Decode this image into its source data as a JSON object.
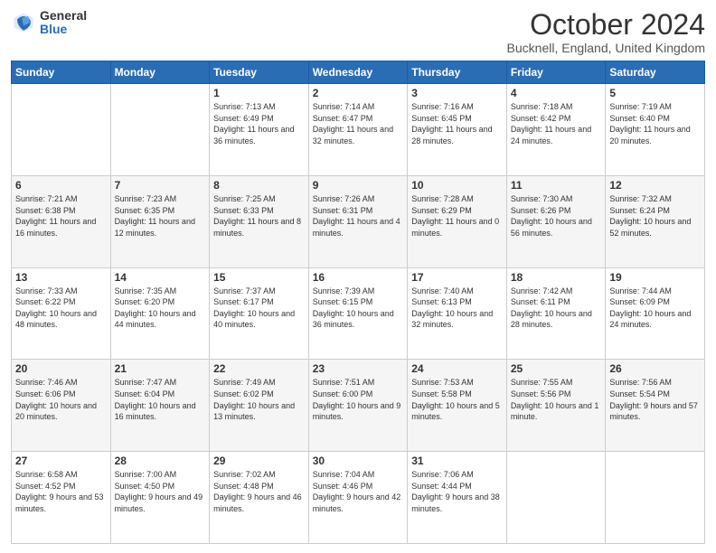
{
  "header": {
    "logo_general": "General",
    "logo_blue": "Blue",
    "title": "October 2024",
    "subtitle": "Bucknell, England, United Kingdom"
  },
  "days_of_week": [
    "Sunday",
    "Monday",
    "Tuesday",
    "Wednesday",
    "Thursday",
    "Friday",
    "Saturday"
  ],
  "weeks": [
    [
      {
        "day": "",
        "info": ""
      },
      {
        "day": "",
        "info": ""
      },
      {
        "day": "1",
        "info": "Sunrise: 7:13 AM\nSunset: 6:49 PM\nDaylight: 11 hours and 36 minutes."
      },
      {
        "day": "2",
        "info": "Sunrise: 7:14 AM\nSunset: 6:47 PM\nDaylight: 11 hours and 32 minutes."
      },
      {
        "day": "3",
        "info": "Sunrise: 7:16 AM\nSunset: 6:45 PM\nDaylight: 11 hours and 28 minutes."
      },
      {
        "day": "4",
        "info": "Sunrise: 7:18 AM\nSunset: 6:42 PM\nDaylight: 11 hours and 24 minutes."
      },
      {
        "day": "5",
        "info": "Sunrise: 7:19 AM\nSunset: 6:40 PM\nDaylight: 11 hours and 20 minutes."
      }
    ],
    [
      {
        "day": "6",
        "info": "Sunrise: 7:21 AM\nSunset: 6:38 PM\nDaylight: 11 hours and 16 minutes."
      },
      {
        "day": "7",
        "info": "Sunrise: 7:23 AM\nSunset: 6:35 PM\nDaylight: 11 hours and 12 minutes."
      },
      {
        "day": "8",
        "info": "Sunrise: 7:25 AM\nSunset: 6:33 PM\nDaylight: 11 hours and 8 minutes."
      },
      {
        "day": "9",
        "info": "Sunrise: 7:26 AM\nSunset: 6:31 PM\nDaylight: 11 hours and 4 minutes."
      },
      {
        "day": "10",
        "info": "Sunrise: 7:28 AM\nSunset: 6:29 PM\nDaylight: 11 hours and 0 minutes."
      },
      {
        "day": "11",
        "info": "Sunrise: 7:30 AM\nSunset: 6:26 PM\nDaylight: 10 hours and 56 minutes."
      },
      {
        "day": "12",
        "info": "Sunrise: 7:32 AM\nSunset: 6:24 PM\nDaylight: 10 hours and 52 minutes."
      }
    ],
    [
      {
        "day": "13",
        "info": "Sunrise: 7:33 AM\nSunset: 6:22 PM\nDaylight: 10 hours and 48 minutes."
      },
      {
        "day": "14",
        "info": "Sunrise: 7:35 AM\nSunset: 6:20 PM\nDaylight: 10 hours and 44 minutes."
      },
      {
        "day": "15",
        "info": "Sunrise: 7:37 AM\nSunset: 6:17 PM\nDaylight: 10 hours and 40 minutes."
      },
      {
        "day": "16",
        "info": "Sunrise: 7:39 AM\nSunset: 6:15 PM\nDaylight: 10 hours and 36 minutes."
      },
      {
        "day": "17",
        "info": "Sunrise: 7:40 AM\nSunset: 6:13 PM\nDaylight: 10 hours and 32 minutes."
      },
      {
        "day": "18",
        "info": "Sunrise: 7:42 AM\nSunset: 6:11 PM\nDaylight: 10 hours and 28 minutes."
      },
      {
        "day": "19",
        "info": "Sunrise: 7:44 AM\nSunset: 6:09 PM\nDaylight: 10 hours and 24 minutes."
      }
    ],
    [
      {
        "day": "20",
        "info": "Sunrise: 7:46 AM\nSunset: 6:06 PM\nDaylight: 10 hours and 20 minutes."
      },
      {
        "day": "21",
        "info": "Sunrise: 7:47 AM\nSunset: 6:04 PM\nDaylight: 10 hours and 16 minutes."
      },
      {
        "day": "22",
        "info": "Sunrise: 7:49 AM\nSunset: 6:02 PM\nDaylight: 10 hours and 13 minutes."
      },
      {
        "day": "23",
        "info": "Sunrise: 7:51 AM\nSunset: 6:00 PM\nDaylight: 10 hours and 9 minutes."
      },
      {
        "day": "24",
        "info": "Sunrise: 7:53 AM\nSunset: 5:58 PM\nDaylight: 10 hours and 5 minutes."
      },
      {
        "day": "25",
        "info": "Sunrise: 7:55 AM\nSunset: 5:56 PM\nDaylight: 10 hours and 1 minute."
      },
      {
        "day": "26",
        "info": "Sunrise: 7:56 AM\nSunset: 5:54 PM\nDaylight: 9 hours and 57 minutes."
      }
    ],
    [
      {
        "day": "27",
        "info": "Sunrise: 6:58 AM\nSunset: 4:52 PM\nDaylight: 9 hours and 53 minutes."
      },
      {
        "day": "28",
        "info": "Sunrise: 7:00 AM\nSunset: 4:50 PM\nDaylight: 9 hours and 49 minutes."
      },
      {
        "day": "29",
        "info": "Sunrise: 7:02 AM\nSunset: 4:48 PM\nDaylight: 9 hours and 46 minutes."
      },
      {
        "day": "30",
        "info": "Sunrise: 7:04 AM\nSunset: 4:46 PM\nDaylight: 9 hours and 42 minutes."
      },
      {
        "day": "31",
        "info": "Sunrise: 7:06 AM\nSunset: 4:44 PM\nDaylight: 9 hours and 38 minutes."
      },
      {
        "day": "",
        "info": ""
      },
      {
        "day": "",
        "info": ""
      }
    ]
  ]
}
